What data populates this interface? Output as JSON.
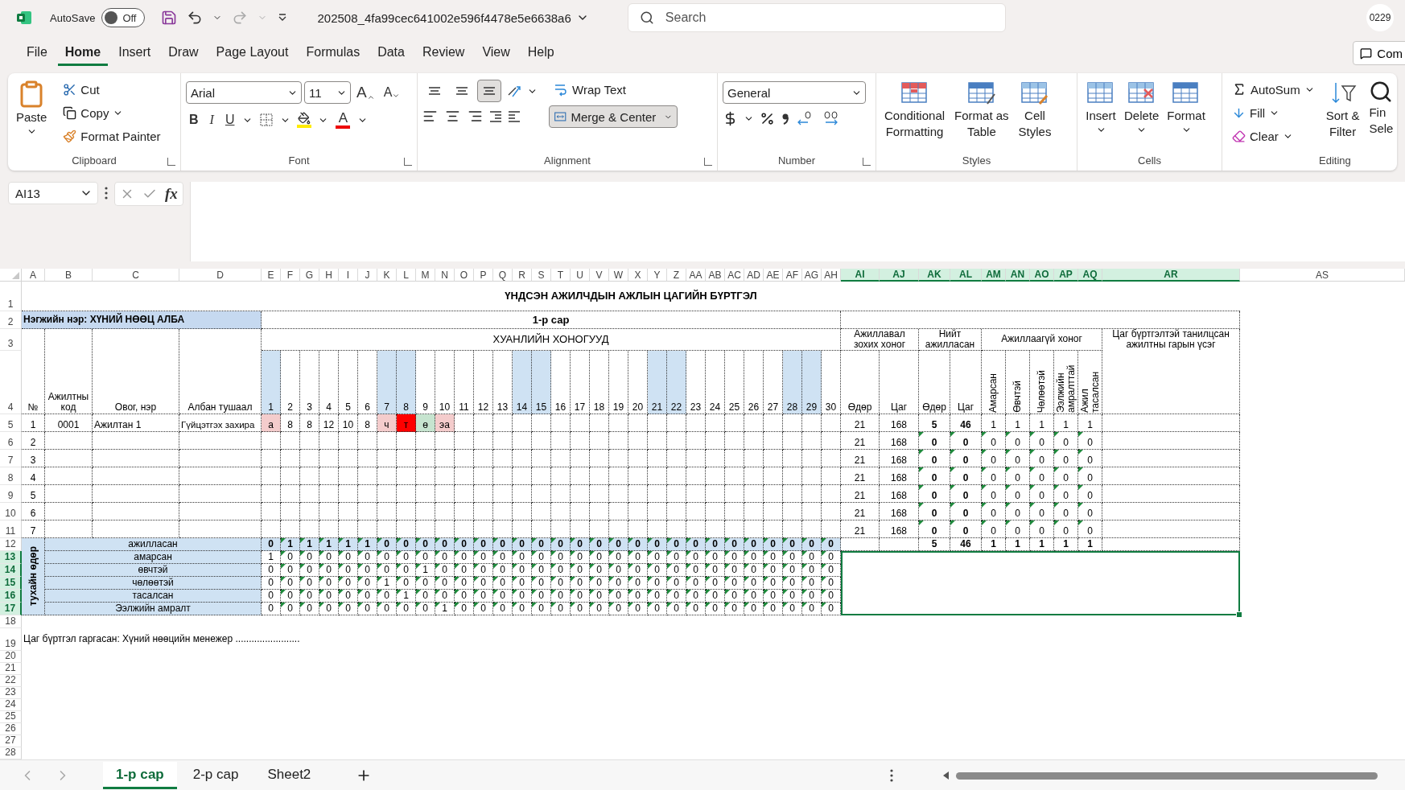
{
  "titlebar": {
    "autosave_label": "AutoSave",
    "autosave": {
      "on": false,
      "label": "Off"
    },
    "file_name": "202508_4fa99cec641002e596f4478e5e6638a6",
    "search_placeholder": "Search",
    "account": "0229"
  },
  "menu": [
    {
      "label": "File",
      "selected": false
    },
    {
      "label": "Home",
      "selected": true
    },
    {
      "label": "Insert",
      "selected": false
    },
    {
      "label": "Draw",
      "selected": false
    },
    {
      "label": "Page Layout",
      "selected": false
    },
    {
      "label": "Formulas",
      "selected": false
    },
    {
      "label": "Data",
      "selected": false
    },
    {
      "label": "Review",
      "selected": false
    },
    {
      "label": "View",
      "selected": false
    },
    {
      "label": "Help",
      "selected": false
    }
  ],
  "comments_button": "Com",
  "ribbon": {
    "clipboard": {
      "title": "Clipboard",
      "paste": "Paste",
      "cut": "Cut",
      "copy": "Copy",
      "format_painter": "Format Painter"
    },
    "font": {
      "title": "Font",
      "name": "Arial",
      "size": "11",
      "grow": "A",
      "shrink": "A",
      "bold": "B",
      "italic": "I",
      "underline": "U",
      "font_color": "A"
    },
    "alignment": {
      "title": "Alignment",
      "valign": [
        {
          "selected": false
        },
        {
          "selected": false
        },
        {
          "selected": true
        }
      ],
      "wrap_text": "Wrap Text",
      "merge_center": "Merge & Center"
    },
    "number": {
      "title": "Number",
      "format": "General"
    },
    "styles": {
      "title": "Styles",
      "conditional": [
        "Conditional",
        "Formatting"
      ],
      "format_table": [
        "Format as",
        "Table"
      ],
      "cell_styles": [
        "Cell",
        "Styles"
      ]
    },
    "cells": {
      "title": "Cells",
      "insert": "Insert",
      "delete": "Delete",
      "format": "Format"
    },
    "editing": {
      "title": "Editing",
      "autosum": "AutoSum",
      "fill": "Fill",
      "clear": "Clear",
      "sort_filter": [
        "Sort &",
        "Filter"
      ],
      "find": [
        "Fin",
        "Sele"
      ]
    }
  },
  "formula_bar": {
    "name_box": "AI13",
    "fx": "fx"
  },
  "sheet": {
    "columns": [
      {
        "label": "A",
        "selected": false
      },
      {
        "label": "B",
        "selected": false
      },
      {
        "label": "C",
        "selected": false
      },
      {
        "label": "D",
        "selected": false
      },
      {
        "label": "E",
        "selected": false
      },
      {
        "label": "F",
        "selected": false
      },
      {
        "label": "G",
        "selected": false
      },
      {
        "label": "H",
        "selected": false
      },
      {
        "label": "I",
        "selected": false
      },
      {
        "label": "J",
        "selected": false
      },
      {
        "label": "K",
        "selected": false
      },
      {
        "label": "L",
        "selected": false
      },
      {
        "label": "M",
        "selected": false
      },
      {
        "label": "N",
        "selected": false
      },
      {
        "label": "O",
        "selected": false
      },
      {
        "label": "P",
        "selected": false
      },
      {
        "label": "Q",
        "selected": false
      },
      {
        "label": "R",
        "selected": false
      },
      {
        "label": "S",
        "selected": false
      },
      {
        "label": "T",
        "selected": false
      },
      {
        "label": "U",
        "selected": false
      },
      {
        "label": "V",
        "selected": false
      },
      {
        "label": "W",
        "selected": false
      },
      {
        "label": "X",
        "selected": false
      },
      {
        "label": "Y",
        "selected": false
      },
      {
        "label": "Z",
        "selected": false
      },
      {
        "label": "AA",
        "selected": false
      },
      {
        "label": "AB",
        "selected": false
      },
      {
        "label": "AC",
        "selected": false
      },
      {
        "label": "AD",
        "selected": false
      },
      {
        "label": "AE",
        "selected": false
      },
      {
        "label": "AF",
        "selected": false
      },
      {
        "label": "AG",
        "selected": false
      },
      {
        "label": "AH",
        "selected": false
      },
      {
        "label": "AI",
        "selected": true
      },
      {
        "label": "AJ",
        "selected": true
      },
      {
        "label": "AK",
        "selected": true
      },
      {
        "label": "AL",
        "selected": true
      },
      {
        "label": "AM",
        "selected": true
      },
      {
        "label": "AN",
        "selected": true
      },
      {
        "label": "AO",
        "selected": true
      },
      {
        "label": "AP",
        "selected": true
      },
      {
        "label": "AQ",
        "selected": true
      },
      {
        "label": "AR",
        "selected": true
      },
      {
        "label": "AS",
        "selected": false
      }
    ],
    "rows": [
      {
        "label": "1",
        "selected": false
      },
      {
        "label": "2",
        "selected": false
      },
      {
        "label": "3",
        "selected": false
      },
      {
        "label": "4",
        "selected": false
      },
      {
        "label": "5",
        "selected": false
      },
      {
        "label": "6",
        "selected": false
      },
      {
        "label": "7",
        "selected": false
      },
      {
        "label": "8",
        "selected": false
      },
      {
        "label": "9",
        "selected": false
      },
      {
        "label": "10",
        "selected": false
      },
      {
        "label": "11",
        "selected": false
      },
      {
        "label": "12",
        "selected": false
      },
      {
        "label": "13",
        "selected": true
      },
      {
        "label": "14",
        "selected": true
      },
      {
        "label": "15",
        "selected": true
      },
      {
        "label": "16",
        "selected": true
      },
      {
        "label": "17",
        "selected": true
      },
      {
        "label": "18",
        "selected": false
      },
      {
        "label": "19",
        "selected": false
      },
      {
        "label": "20",
        "selected": false
      },
      {
        "label": "21",
        "selected": false
      },
      {
        "label": "22",
        "selected": false
      },
      {
        "label": "23",
        "selected": false
      },
      {
        "label": "24",
        "selected": false
      },
      {
        "label": "25",
        "selected": false
      },
      {
        "label": "26",
        "selected": false
      },
      {
        "label": "27",
        "selected": false
      },
      {
        "label": "28",
        "selected": false
      }
    ],
    "title": "ҮНДСЭН АЖИЛЧДЫН АЖЛЫН ЦАГИЙН БҮРТГЭЛ",
    "unit": "Нэгжийн нэр: ХҮНИЙ НӨӨЦ АЛБА",
    "month": "1-р сар",
    "days_heading": "ХУАНЛИЙН ХОНОГУУД",
    "header": {
      "no": "№",
      "code": "Ажилтны код",
      "name": "Овог, нэр",
      "position": "Албан тушаал",
      "plan": "Ажиллавал зохих хоног",
      "total": "Нийт ажилласан",
      "absent": "Ажиллаагүй хоног",
      "plan_day": "Өдөр",
      "plan_hour": "Цаг",
      "worked_day": "Өдөр",
      "worked_hour": "Цаг",
      "absent_types": [
        "Амарсан",
        "Өвчтэй",
        "Чөлөөтэй",
        "Ээлжийн амралттай",
        "Ажил тасалсан"
      ],
      "signature": "Цаг бүртгэлтэй танилцсан ажилтны гарын үсэг"
    },
    "days": [
      {
        "label": "1",
        "weekend": true
      },
      {
        "label": "2",
        "weekend": false
      },
      {
        "label": "3",
        "weekend": false
      },
      {
        "label": "4",
        "weekend": false
      },
      {
        "label": "5",
        "weekend": false
      },
      {
        "label": "6",
        "weekend": false
      },
      {
        "label": "7",
        "weekend": true
      },
      {
        "label": "8",
        "weekend": true
      },
      {
        "label": "9",
        "weekend": false
      },
      {
        "label": "10",
        "weekend": false
      },
      {
        "label": "11",
        "weekend": false
      },
      {
        "label": "12",
        "weekend": false
      },
      {
        "label": "13",
        "weekend": false
      },
      {
        "label": "14",
        "weekend": true
      },
      {
        "label": "15",
        "weekend": true
      },
      {
        "label": "16",
        "weekend": false
      },
      {
        "label": "17",
        "weekend": false
      },
      {
        "label": "18",
        "weekend": false
      },
      {
        "label": "19",
        "weekend": false
      },
      {
        "label": "20",
        "weekend": false
      },
      {
        "label": "21",
        "weekend": true
      },
      {
        "label": "22",
        "weekend": true
      },
      {
        "label": "23",
        "weekend": false
      },
      {
        "label": "24",
        "weekend": false
      },
      {
        "label": "25",
        "weekend": false
      },
      {
        "label": "26",
        "weekend": false
      },
      {
        "label": "27",
        "weekend": false
      },
      {
        "label": "28",
        "weekend": true
      },
      {
        "label": "29",
        "weekend": true
      },
      {
        "label": "30",
        "weekend": false
      }
    ],
    "employees": [
      {
        "no": "1",
        "code": "0001",
        "name": "Ажилтан 1",
        "position": "Гүйцэтгэх захира",
        "days": [
          {
            "text": "а",
            "color": "#f4cccc"
          },
          {
            "text": "8"
          },
          {
            "text": "8"
          },
          {
            "text": "12"
          },
          {
            "text": "10"
          },
          {
            "text": "8"
          },
          {
            "text": "ч",
            "color": "#f4cccc"
          },
          {
            "text": "т",
            "color": "#ff0000"
          },
          {
            "text": "ө",
            "color": "#c6e4cf"
          },
          {
            "text": "эа",
            "color": "#f4cccc"
          }
        ],
        "plan_days": "21",
        "plan_hours": "168",
        "worked_days": "5",
        "worked_hours": "46",
        "absent": [
          "1",
          "1",
          "1",
          "1",
          "1"
        ]
      },
      {
        "no": "2",
        "error_marks": true,
        "plan_days": "21",
        "plan_hours": "168",
        "worked_days": "0",
        "worked_hours": "0",
        "absent": [
          "0",
          "0",
          "0",
          "0",
          "0"
        ]
      },
      {
        "no": "3",
        "error_marks": true,
        "plan_days": "21",
        "plan_hours": "168",
        "worked_days": "0",
        "worked_hours": "0",
        "absent": [
          "0",
          "0",
          "0",
          "0",
          "0"
        ]
      },
      {
        "no": "4",
        "error_marks": true,
        "plan_days": "21",
        "plan_hours": "168",
        "worked_days": "0",
        "worked_hours": "0",
        "absent": [
          "0",
          "0",
          "0",
          "0",
          "0"
        ]
      },
      {
        "no": "5",
        "error_marks": true,
        "plan_days": "21",
        "plan_hours": "168",
        "worked_days": "0",
        "worked_hours": "0",
        "absent": [
          "0",
          "0",
          "0",
          "0",
          "0"
        ]
      },
      {
        "no": "6",
        "error_marks": true,
        "plan_days": "21",
        "plan_hours": "168",
        "worked_days": "0",
        "worked_hours": "0",
        "absent": [
          "0",
          "0",
          "0",
          "0",
          "0"
        ]
      },
      {
        "no": "7",
        "error_marks": true,
        "plan_days": "21",
        "plan_hours": "168",
        "worked_days": "0",
        "worked_hours": "0",
        "absent": [
          "0",
          "0",
          "0",
          "0",
          "0"
        ]
      }
    ],
    "summary": {
      "side_label": "тухайн өдөр",
      "rows": [
        {
          "label": "ажилласан",
          "kind": "total",
          "error_marks": true,
          "values": [
            "0",
            "1",
            "1",
            "1",
            "1",
            "1",
            "0",
            "0",
            "0",
            "0",
            "0",
            "0",
            "0",
            "0",
            "0",
            "0",
            "0",
            "0",
            "0",
            "0",
            "0",
            "0",
            "0",
            "0",
            "0",
            "0",
            "0",
            "0",
            "0",
            "0"
          ],
          "totals": [
            "5",
            "46",
            "1",
            "1",
            "1",
            "1",
            "1"
          ]
        },
        {
          "label": "амарсан",
          "kind": "count",
          "error_marks": true,
          "values": [
            "1",
            "0",
            "0",
            "0",
            "0",
            "0",
            "0",
            "0",
            "0",
            "0",
            "0",
            "0",
            "0",
            "0",
            "0",
            "0",
            "0",
            "0",
            "0",
            "0",
            "0",
            "0",
            "0",
            "0",
            "0",
            "0",
            "0",
            "0",
            "0",
            "0"
          ]
        },
        {
          "label": "өвчтэй",
          "kind": "count",
          "error_marks": true,
          "values": [
            "0",
            "0",
            "0",
            "0",
            "0",
            "0",
            "0",
            "0",
            "1",
            "0",
            "0",
            "0",
            "0",
            "0",
            "0",
            "0",
            "0",
            "0",
            "0",
            "0",
            "0",
            "0",
            "0",
            "0",
            "0",
            "0",
            "0",
            "0",
            "0",
            "0"
          ]
        },
        {
          "label": "чөлөөтэй",
          "kind": "count",
          "error_marks": true,
          "values": [
            "0",
            "0",
            "0",
            "0",
            "0",
            "0",
            "1",
            "0",
            "0",
            "0",
            "0",
            "0",
            "0",
            "0",
            "0",
            "0",
            "0",
            "0",
            "0",
            "0",
            "0",
            "0",
            "0",
            "0",
            "0",
            "0",
            "0",
            "0",
            "0",
            "0"
          ]
        },
        {
          "label": "тасалсан",
          "kind": "count",
          "error_marks": true,
          "values": [
            "0",
            "0",
            "0",
            "0",
            "0",
            "0",
            "0",
            "1",
            "0",
            "0",
            "0",
            "0",
            "0",
            "0",
            "0",
            "0",
            "0",
            "0",
            "0",
            "0",
            "0",
            "0",
            "0",
            "0",
            "0",
            "0",
            "0",
            "0",
            "0",
            "0"
          ]
        },
        {
          "label": "Ээлжийн амралт",
          "kind": "count",
          "error_marks": true,
          "values": [
            "0",
            "0",
            "0",
            "0",
            "0",
            "0",
            "0",
            "0",
            "0",
            "1",
            "0",
            "0",
            "0",
            "0",
            "0",
            "0",
            "0",
            "0",
            "0",
            "0",
            "0",
            "0",
            "0",
            "0",
            "0",
            "0",
            "0",
            "0",
            "0",
            "0"
          ]
        }
      ]
    },
    "footer": "Цаг бүртгэл гаргасан: Хүний нөөцийн менежер ........................"
  },
  "sheet_tabs": [
    {
      "label": "1-р сар",
      "selected": true
    },
    {
      "label": "2-р сар",
      "selected": false
    },
    {
      "label": "Sheet2",
      "selected": false
    }
  ]
}
